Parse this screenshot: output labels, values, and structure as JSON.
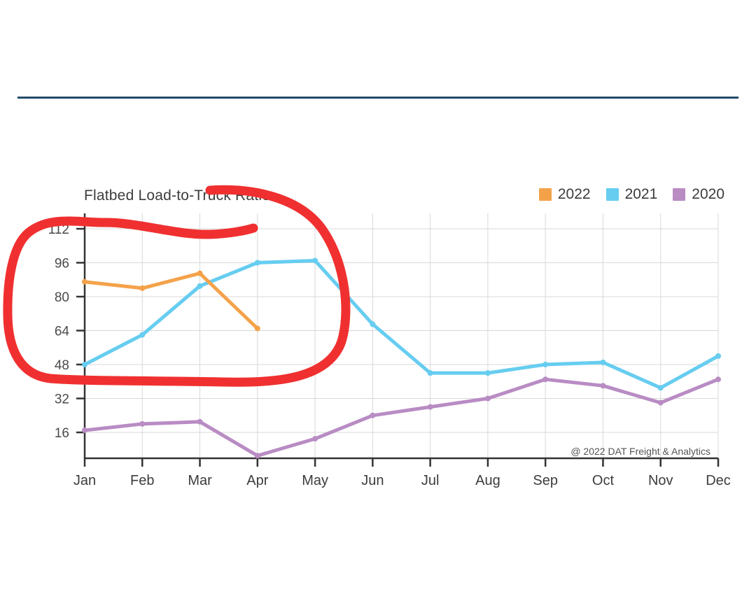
{
  "chart_data": {
    "type": "line",
    "title": "Flatbed Load-to-Truck Ratio",
    "xlabel": "",
    "ylabel": "",
    "categories": [
      "Jan",
      "Feb",
      "Mar",
      "Apr",
      "May",
      "Jun",
      "Jul",
      "Aug",
      "Sep",
      "Oct",
      "Nov",
      "Dec"
    ],
    "ylim": [
      8,
      120
    ],
    "yticks": [
      16,
      32,
      48,
      64,
      80,
      96,
      112
    ],
    "grid": true,
    "legend_position": "top-right",
    "series": [
      {
        "name": "2022",
        "color": "#f4a24a",
        "values": [
          87,
          84,
          91,
          65,
          null,
          null,
          null,
          null,
          null,
          null,
          null,
          null
        ]
      },
      {
        "name": "2021",
        "color": "#66cdf0",
        "values": [
          48,
          62,
          85,
          96,
          97,
          67,
          44,
          44,
          48,
          49,
          37,
          52
        ]
      },
      {
        "name": "2020",
        "color": "#b98cc4",
        "values": [
          17,
          20,
          21,
          5,
          13,
          24,
          28,
          32,
          41,
          38,
          30,
          41
        ]
      }
    ],
    "attribution": "@ 2022 DAT Freight & Analytics"
  },
  "annotation": {
    "name": "red-lasso-circle",
    "color": "#f03030",
    "description": "hand-drawn red oval circling Jan through May"
  },
  "divider": {
    "color": "#214b66"
  }
}
